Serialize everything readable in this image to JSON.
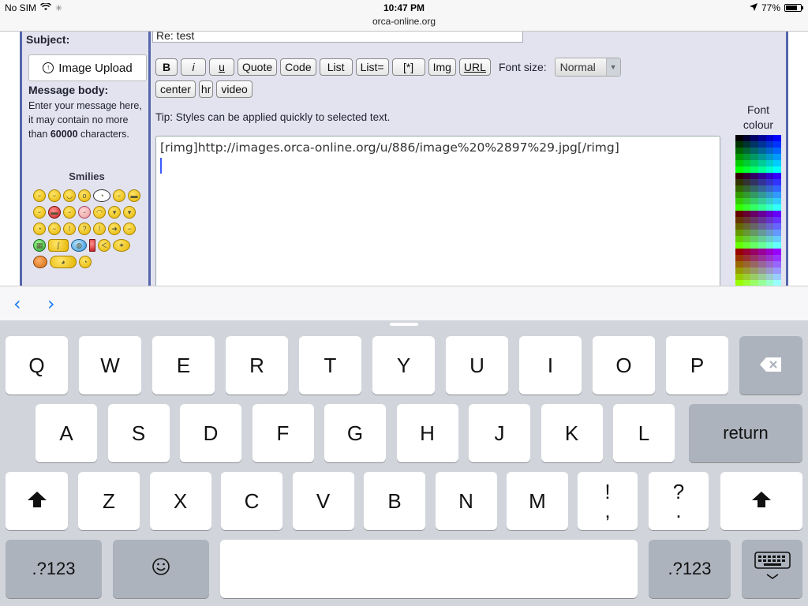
{
  "status_bar": {
    "carrier": "No SIM",
    "time": "10:47 PM",
    "battery": "77%",
    "battery_level": 0.77,
    "url": "orca-online.org"
  },
  "form": {
    "subject_label": "Subject:",
    "subject_value": "Re: test",
    "image_upload_label": "Image Upload",
    "message_body_label": "Message body:",
    "message_help_prefix": "Enter your message here, it may contain no more than ",
    "message_help_limit": "60000",
    "message_help_suffix": " characters.",
    "smilies_title": "Smilies",
    "tip": "Tip: Styles can be applied quickly to selected text.",
    "editor_text": "[rimg]http://images.orca-online.org/u/886/image%20%2897%29.jpg[/rimg]",
    "font_colour_label_1": "Font",
    "font_colour_label_2": "colour"
  },
  "toolbar": {
    "bold": "B",
    "italic": "i",
    "underline": "u",
    "quote": "Quote",
    "code": "Code",
    "list": "List",
    "list_eq": "List=",
    "list_item": "[*]",
    "img": "Img",
    "url": "URL",
    "font_size_label": "Font size:",
    "font_size_value": "Normal",
    "center": "center",
    "hr": "hr",
    "video": "video"
  },
  "accessory": {
    "prev_icon": "chevron-left-icon",
    "next_icon": "chevron-right-icon"
  },
  "keyboard": {
    "row1": [
      "Q",
      "W",
      "E",
      "R",
      "T",
      "Y",
      "U",
      "I",
      "O",
      "P"
    ],
    "row2": [
      "A",
      "S",
      "D",
      "F",
      "G",
      "H",
      "J",
      "K",
      "L"
    ],
    "row3": [
      "Z",
      "X",
      "C",
      "V",
      "B",
      "N",
      "M"
    ],
    "return": "return",
    "numbers": ".?123",
    "excl_top": "!",
    "excl_bottom": ",",
    "quest_top": "?",
    "quest_bottom": "."
  },
  "colors": {
    "accent": "#1d7cf2",
    "frame": "#5566aa",
    "panel": "#e2e3ef"
  }
}
